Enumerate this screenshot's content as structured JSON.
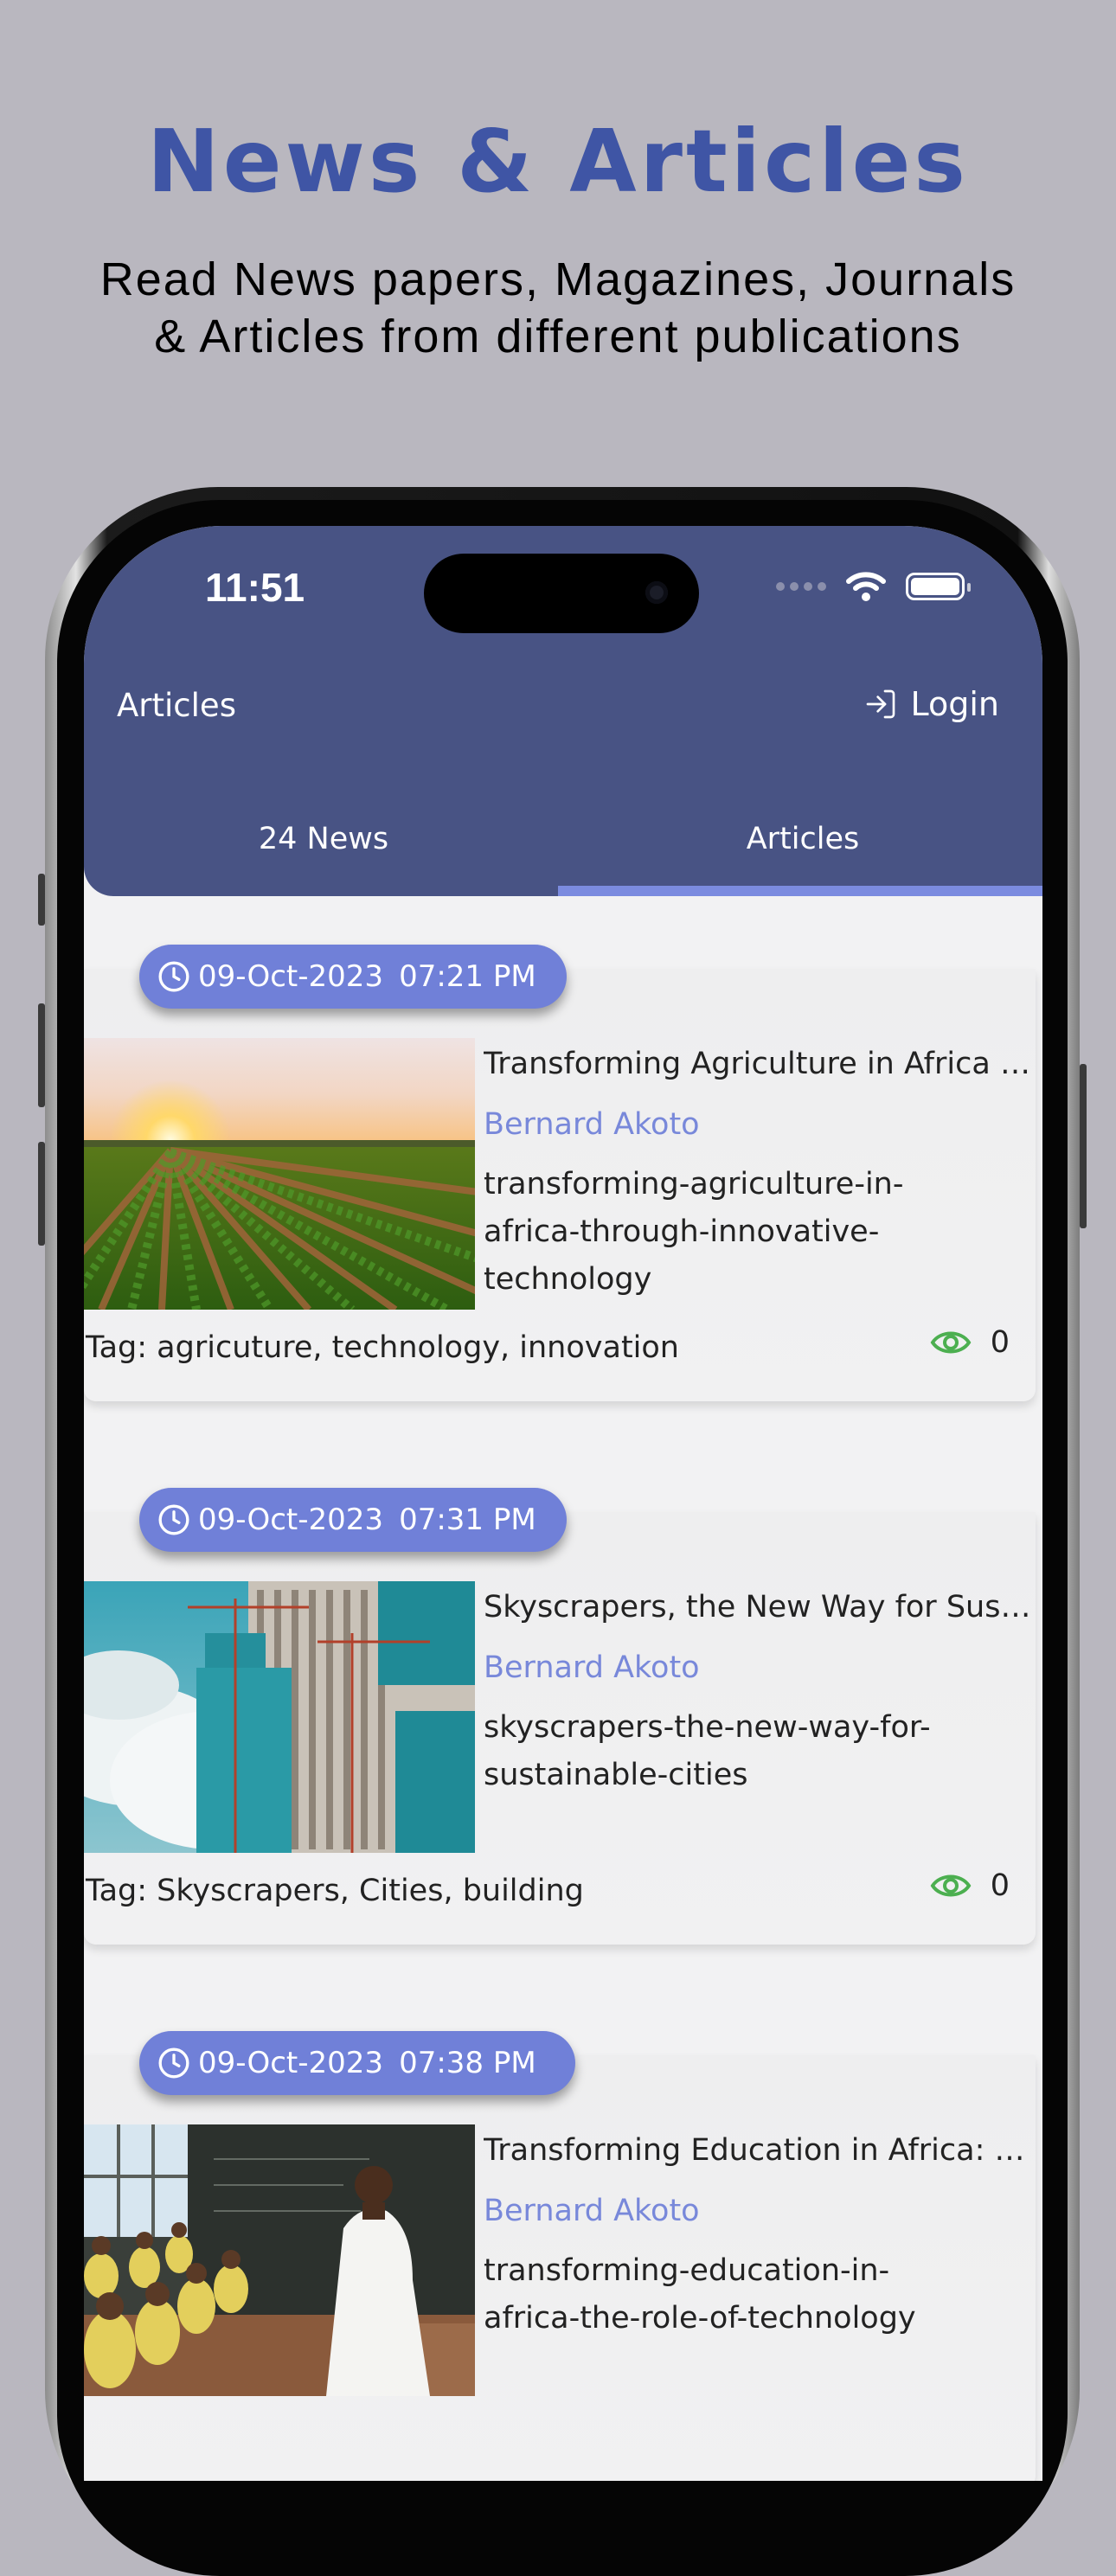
{
  "promo": {
    "title": "News & Articles",
    "subtitle_line1": "Read News papers, Magazines, Journals",
    "subtitle_line2": "& Articles from different publications"
  },
  "status_bar": {
    "time": "11:51"
  },
  "header": {
    "title": "Articles",
    "login_label": "Login"
  },
  "tabs": [
    {
      "label": "24 News",
      "active": false
    },
    {
      "label": "Articles",
      "active": true
    }
  ],
  "articles": [
    {
      "date": "09-Oct-2023",
      "time": "07:21 PM",
      "title": "Transforming Agriculture in Africa Through Innovative Technology",
      "author": "Bernard Akoto",
      "slug": "transforming-agriculture-in-africa-through-innovative-technology",
      "tags": "Tag: agricuture, technology, innovation",
      "views": "0",
      "image": "farm-field-sunset"
    },
    {
      "date": "09-Oct-2023",
      "time": "07:31 PM",
      "title": "Skyscrapers, the New Way for Sustainable Cities",
      "author": "Bernard Akoto",
      "slug": "skyscrapers-the-new-way-for-sustainable-cities",
      "tags": "Tag: Skyscrapers, Cities, building",
      "views": "0",
      "image": "skyscraper-construction"
    },
    {
      "date": "09-Oct-2023",
      "time": "07:38 PM",
      "title": "Transforming Education in Africa: The Role of Technology",
      "author": "Bernard Akoto",
      "slug": "transforming-education-in-africa-the-role-of-technology",
      "tags": "",
      "views": "",
      "image": "classroom-teacher"
    }
  ],
  "colors": {
    "header_bg": "#485384",
    "accent": "#7080d8",
    "promo_title": "#3f55a5",
    "eye_icon": "#4caf50"
  }
}
